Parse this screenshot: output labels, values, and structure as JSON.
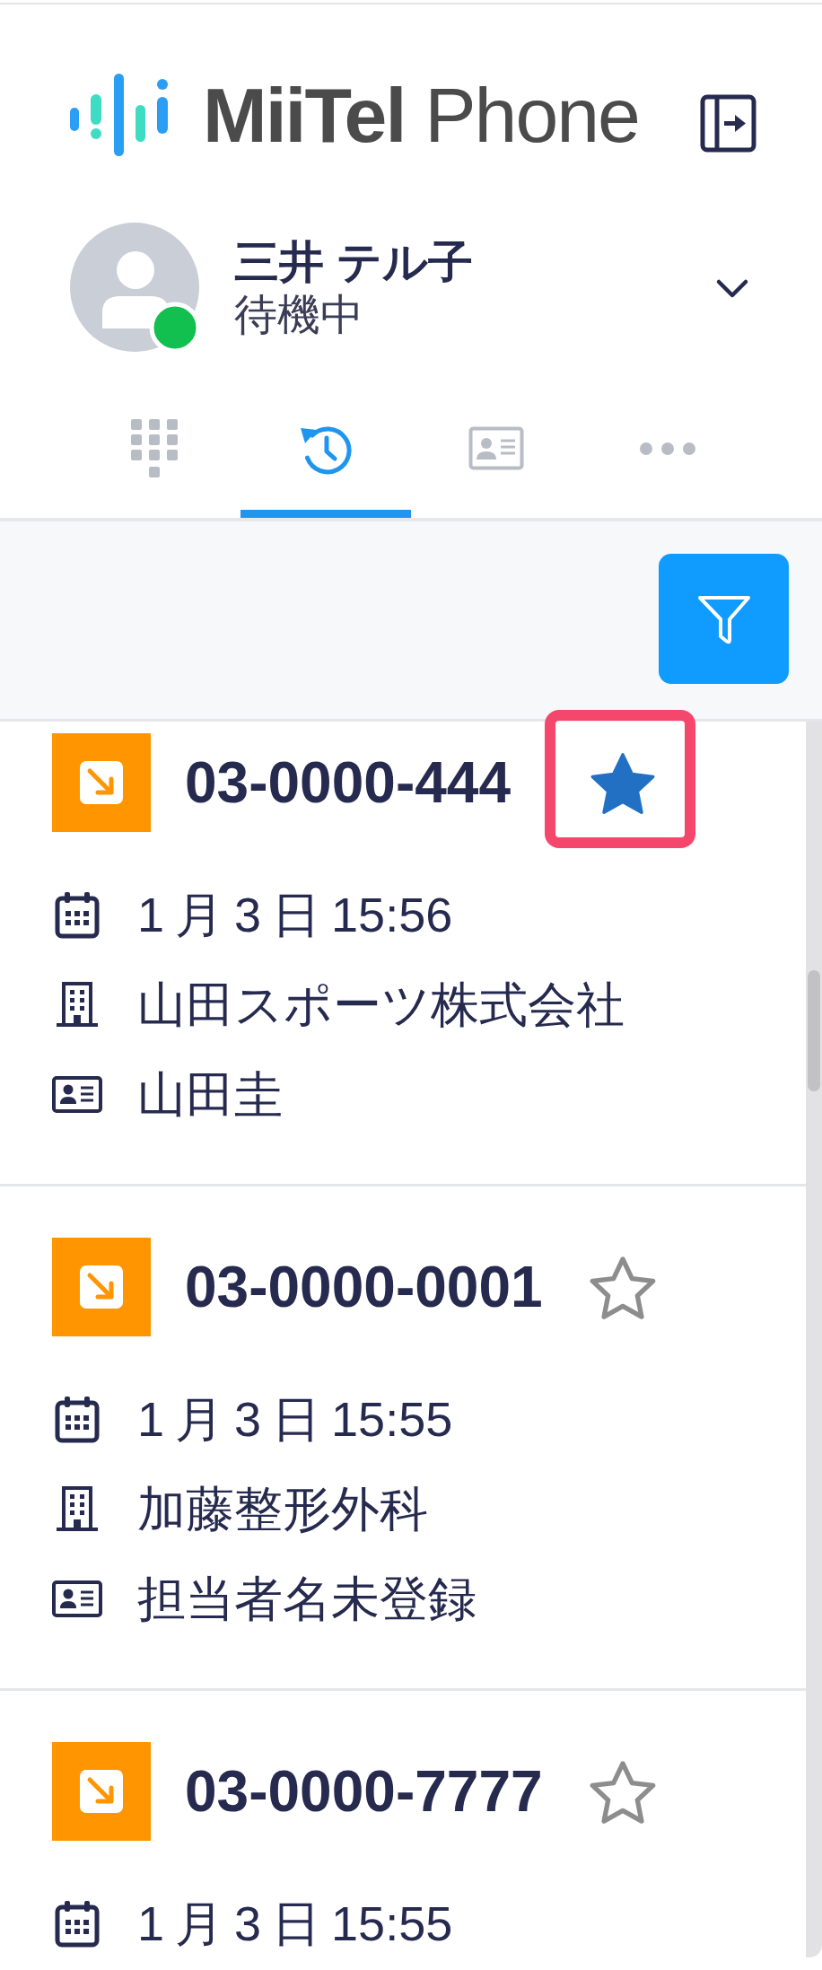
{
  "logo": {
    "text": "**MiiTel** Phone"
  },
  "user": {
    "name": "三井 テル子",
    "status": "待機中",
    "online": true
  },
  "tabs": [
    {
      "kind": "keypad",
      "selected": false
    },
    {
      "kind": "history",
      "selected": true
    },
    {
      "kind": "contacts",
      "selected": false
    },
    {
      "kind": "more",
      "selected": false
    }
  ],
  "calls": [
    {
      "kind": "incoming",
      "number": "03-0000-444",
      "starred": true,
      "highlighted": true,
      "details": [
        {
          "kind": "date",
          "text": "1 月 3 日 15:56"
        },
        {
          "kind": "company",
          "text": "山田スポーツ株式会社"
        },
        {
          "kind": "contact",
          "text": "山田圭"
        }
      ]
    },
    {
      "kind": "incoming",
      "number": "03-0000-0001",
      "starred": false,
      "highlighted": false,
      "details": [
        {
          "kind": "date",
          "text": "1 月 3 日 15:55"
        },
        {
          "kind": "company",
          "text": "加藤整形外科"
        },
        {
          "kind": "contact",
          "text": "担当者名未登録"
        }
      ]
    },
    {
      "kind": "incoming",
      "number": "03-0000-7777",
      "starred": false,
      "highlighted": false,
      "details": [
        {
          "kind": "date",
          "text": "1 月 3 日 15:55"
        }
      ]
    }
  ]
}
